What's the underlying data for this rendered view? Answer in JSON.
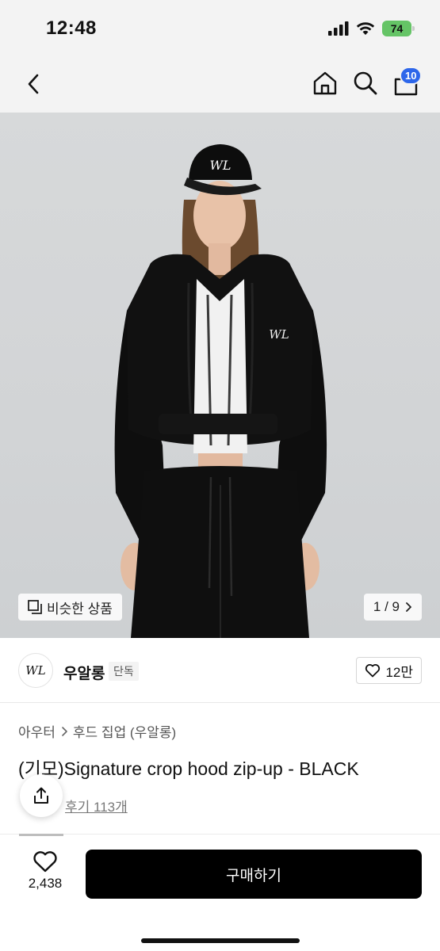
{
  "status_bar": {
    "time": "12:48",
    "battery": "74"
  },
  "nav": {
    "back_icon": "chevron-left-icon",
    "home_icon": "home-icon",
    "search_icon": "search-icon",
    "bag_icon": "shopping-bag-icon",
    "bag_badge": "10",
    "badge_color": "#2d66ea"
  },
  "gallery": {
    "similar_label": "비슷한 상품",
    "pager": "1 / 9"
  },
  "brand": {
    "logo_text": "WL",
    "name": "우알롱",
    "tag": "단독",
    "likes": "12만"
  },
  "product": {
    "breadcrumb": [
      "아우터",
      "후드 집업 (우알롱)"
    ],
    "title": "(기모)Signature crop hood zip-up - BLACK",
    "review": "후기 113개"
  },
  "bottom": {
    "wish_count": "2,438",
    "buy_label": "구매하기"
  }
}
